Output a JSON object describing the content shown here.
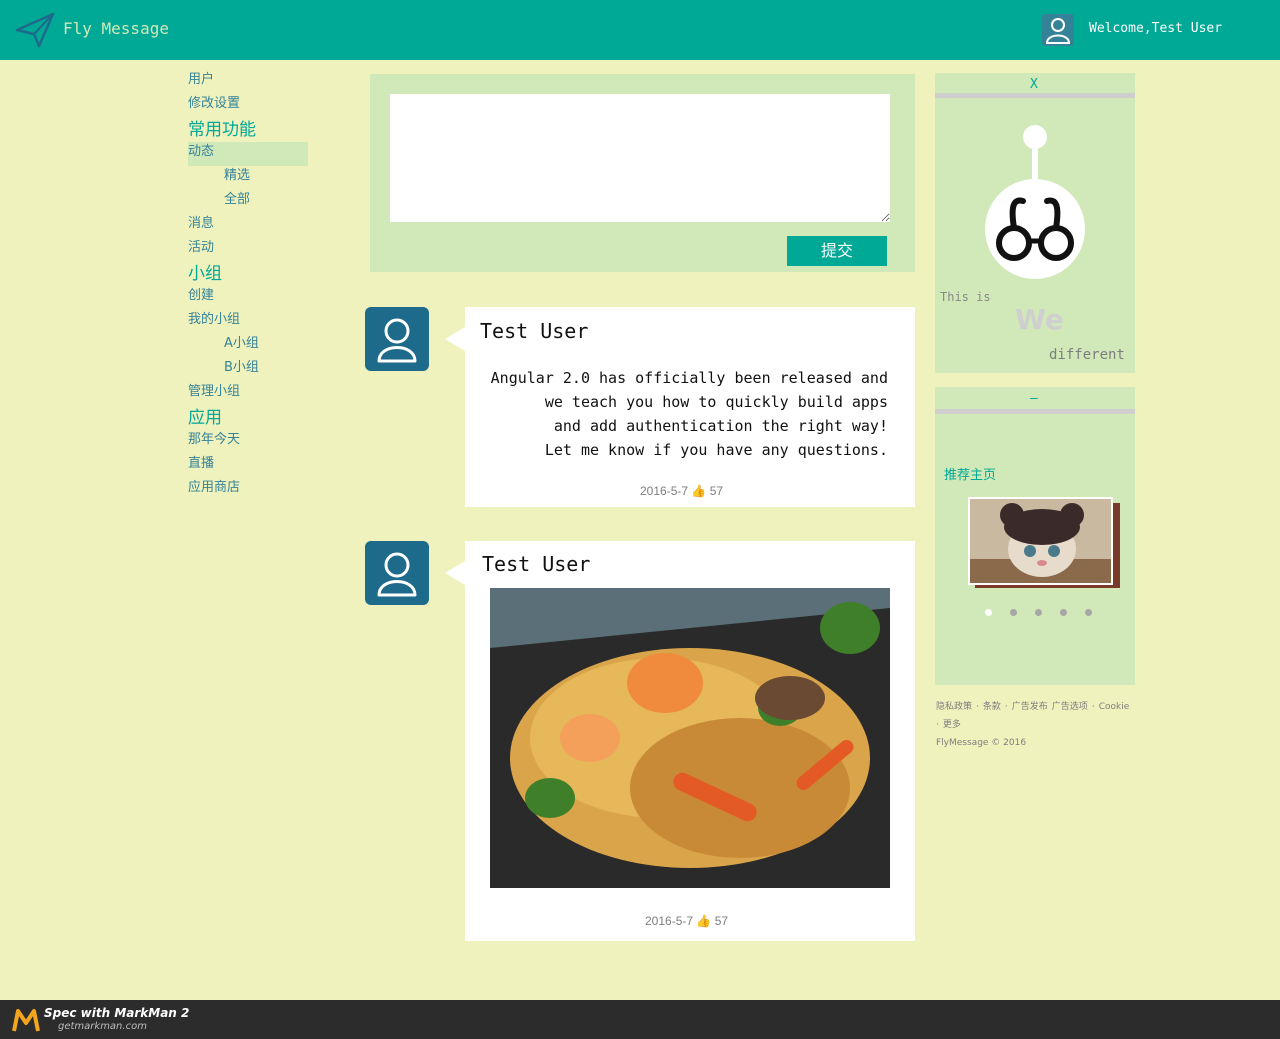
{
  "header": {
    "app_name": "Fly Message",
    "welcome": "Welcome,Test User"
  },
  "nav": {
    "items": [
      {
        "label": "用户",
        "type": "item"
      },
      {
        "label": "修改设置",
        "type": "item"
      },
      {
        "label": "常用功能",
        "type": "group"
      },
      {
        "label": "动态",
        "type": "item",
        "active": true
      },
      {
        "label": "精选",
        "type": "sub"
      },
      {
        "label": "全部",
        "type": "sub"
      },
      {
        "label": "消息",
        "type": "item"
      },
      {
        "label": "活动",
        "type": "item"
      },
      {
        "label": "小组",
        "type": "group"
      },
      {
        "label": "创建",
        "type": "item"
      },
      {
        "label": "我的小组",
        "type": "item"
      },
      {
        "label": "A小组",
        "type": "sub"
      },
      {
        "label": "B小组",
        "type": "sub"
      },
      {
        "label": "管理小组",
        "type": "item"
      },
      {
        "label": "应用",
        "type": "group"
      },
      {
        "label": "那年今天",
        "type": "item"
      },
      {
        "label": "直播",
        "type": "item"
      },
      {
        "label": "应用商店",
        "type": "item"
      }
    ]
  },
  "composer": {
    "input_value": "",
    "submit_label": "提交"
  },
  "posts": [
    {
      "author": "Test User",
      "body_lines": [
        "Angular 2.0 has officially been released and",
        "we teach you how to quickly build apps",
        "and add authentication the right way!",
        "Let me know if you have any questions."
      ],
      "date": "2016-5-7",
      "likes": "57"
    },
    {
      "author": "Test User",
      "image": "noodles-with-shrimp-photo",
      "date": "2016-5-7",
      "likes": "57"
    }
  ],
  "widget_motto": {
    "close_label": "X",
    "line1": "This is",
    "line2": "We",
    "line3": "different"
  },
  "widget_recommend": {
    "minimize_label": "–",
    "title": "推荐主页",
    "image": "cat-with-hat-photo",
    "dot_count": 5,
    "active_dot": 0
  },
  "footer": {
    "links": [
      "隐私政策",
      "·",
      "条款",
      "·",
      "广告发布",
      "广告选项",
      "·",
      "Cookie",
      "·",
      "更多"
    ],
    "copyright": "FlyMessage © 2016"
  },
  "markman": {
    "title": "Spec with MarkMan 2",
    "url": "getmarkman.com"
  },
  "colors": {
    "header": "#00a896",
    "panel": "#d1e9b8",
    "nav_text": "#348297",
    "group_text": "#00a896",
    "muted": "#7e7e7e",
    "dot": "#a7a7a7",
    "background": "#f0f2be"
  }
}
